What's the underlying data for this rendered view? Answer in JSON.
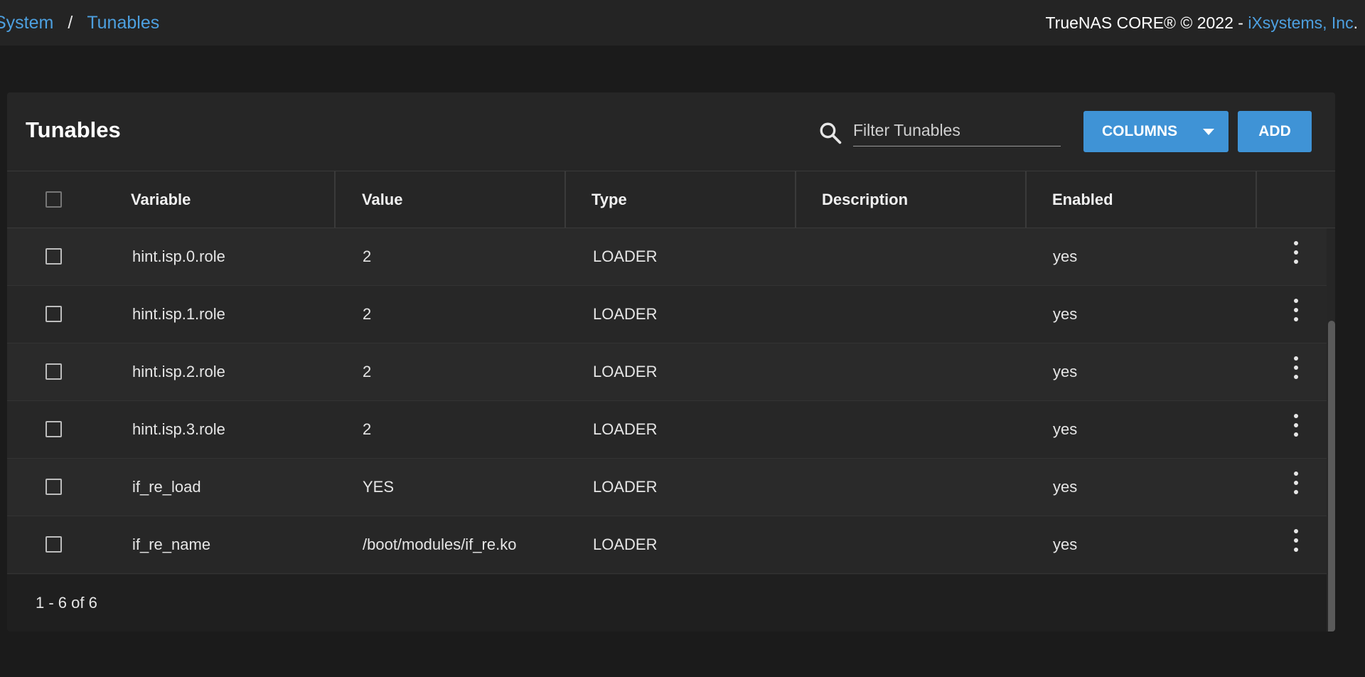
{
  "breadcrumb": {
    "items": [
      {
        "label": "System"
      },
      {
        "label": "Tunables"
      }
    ],
    "separator": "/"
  },
  "copyright": {
    "text": "TrueNAS CORE® © 2022 - ",
    "link": "iXsystems, Inc",
    "suffix": "."
  },
  "card": {
    "title": "Tunables",
    "filter_placeholder": "Filter Tunables",
    "columns_button": "COLUMNS",
    "add_button": "ADD"
  },
  "table": {
    "columns": [
      "Variable",
      "Value",
      "Type",
      "Description",
      "Enabled"
    ],
    "rows": [
      {
        "variable": "hint.isp.0.role",
        "value": "2",
        "type": "LOADER",
        "description": "",
        "enabled": "yes"
      },
      {
        "variable": "hint.isp.1.role",
        "value": "2",
        "type": "LOADER",
        "description": "",
        "enabled": "yes"
      },
      {
        "variable": "hint.isp.2.role",
        "value": "2",
        "type": "LOADER",
        "description": "",
        "enabled": "yes"
      },
      {
        "variable": "hint.isp.3.role",
        "value": "2",
        "type": "LOADER",
        "description": "",
        "enabled": "yes"
      },
      {
        "variable": "if_re_load",
        "value": "YES",
        "type": "LOADER",
        "description": "",
        "enabled": "yes"
      },
      {
        "variable": "if_re_name",
        "value": "/boot/modules/if_re.ko",
        "type": "LOADER",
        "description": "",
        "enabled": "yes"
      }
    ],
    "paginator": "1 - 6 of 6"
  },
  "colors": {
    "accent": "#3f93d6",
    "link": "#4da0e0",
    "background": "#1b1b1b",
    "card": "#262626"
  }
}
